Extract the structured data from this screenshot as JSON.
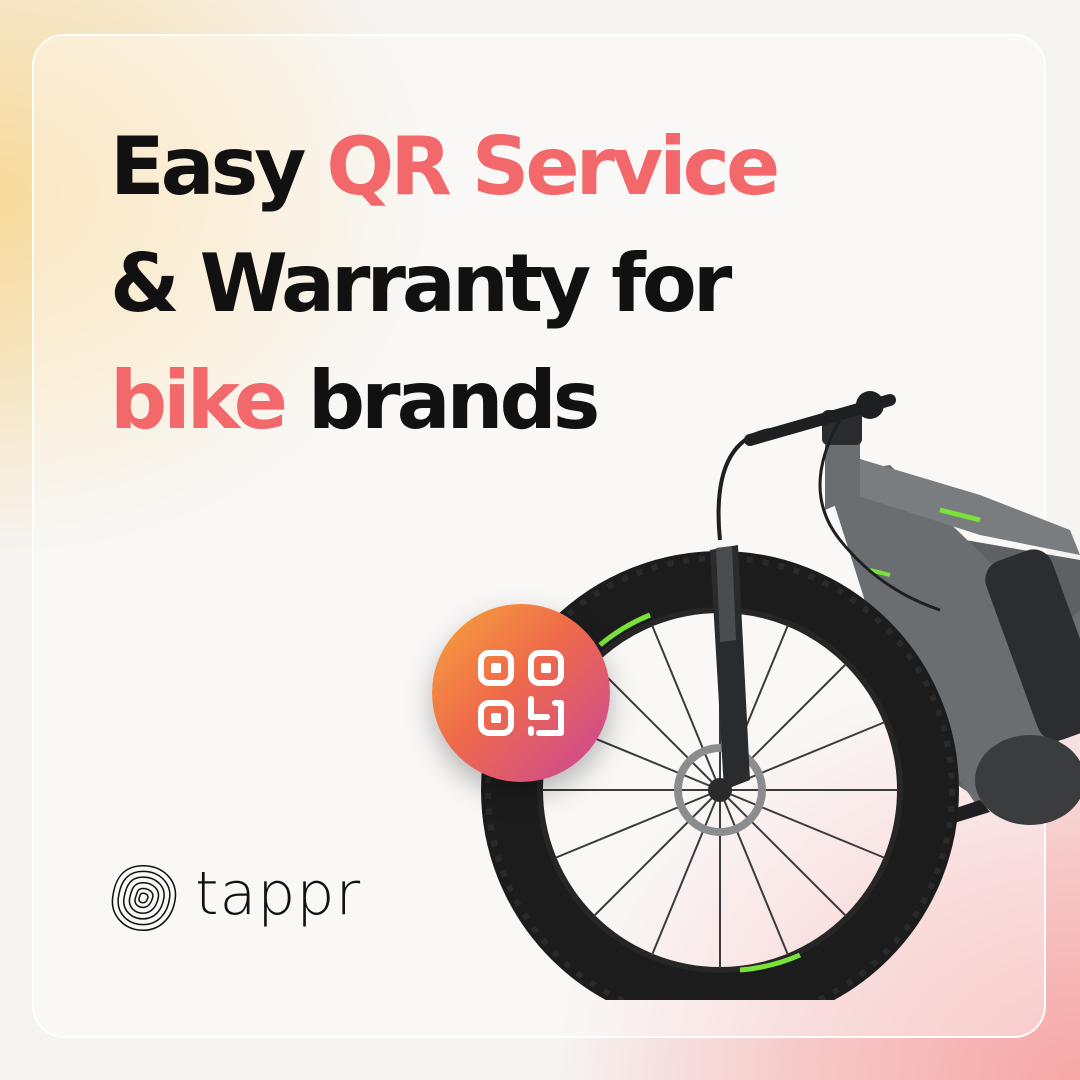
{
  "headline": {
    "line1_a": "Easy ",
    "line1_b": "QR Service",
    "line2": "& Warranty for",
    "line3_a": "bike",
    "line3_b": " brands"
  },
  "brand": {
    "name": "tappr"
  },
  "icons": {
    "badge": "qr-code-icon",
    "logo": "tappr-logo-icon"
  },
  "colors": {
    "accent": "#f2686b",
    "text": "#111111",
    "badge_start": "#f6a53a",
    "badge_end": "#c8459a"
  }
}
